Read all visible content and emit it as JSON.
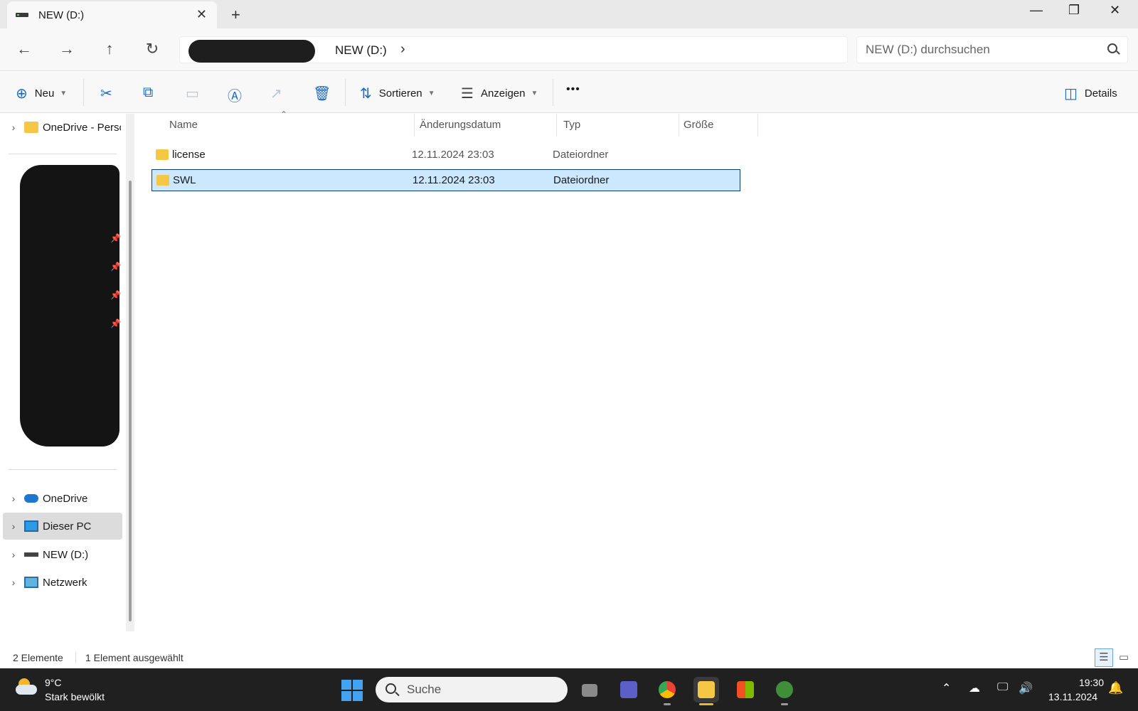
{
  "window": {
    "tab_title": "NEW (D:)",
    "tab_close": "✕",
    "new_tab": "+",
    "minimize": "—",
    "maximize": "❐",
    "close": "✕"
  },
  "nav": {
    "back": "←",
    "forward": "→",
    "up": "↑",
    "refresh": "↻",
    "breadcrumb": "NEW (D:)",
    "breadcrumb_chevron": "›",
    "search_placeholder": "NEW (D:) durchsuchen"
  },
  "commands": {
    "new_label": "Neu",
    "sort_label": "Sortieren",
    "view_label": "Anzeigen",
    "more": "•••",
    "details_label": "Details"
  },
  "sidebar": {
    "top_item": "OneDrive - Perso",
    "items": [
      {
        "label": "OneDrive",
        "icon": "onedrive-icon"
      },
      {
        "label": "Dieser PC",
        "icon": "pc-icon",
        "selected": true
      },
      {
        "label": "NEW (D:)",
        "icon": "drive-icon"
      },
      {
        "label": "Netzwerk",
        "icon": "network-icon"
      }
    ]
  },
  "columns": {
    "name": "Name",
    "modified": "Änderungsdatum",
    "type": "Typ",
    "size": "Größe"
  },
  "files": [
    {
      "name": "license",
      "modified": "12.11.2024 23:03",
      "type": "Dateiordner",
      "selected": false
    },
    {
      "name": "SWL",
      "modified": "12.11.2024 23:03",
      "type": "Dateiordner",
      "selected": true
    }
  ],
  "status": {
    "count": "2 Elemente",
    "selection": "1 Element ausgewählt"
  },
  "taskbar": {
    "temperature": "9°C",
    "condition": "Stark bewölkt",
    "search_label": "Suche",
    "time": "19:30",
    "date": "13.11.2024"
  },
  "colors": {
    "accent": "#1c6bbf",
    "selection": "#cce8ff",
    "folder": "#f6c745",
    "taskbar": "#202020"
  }
}
